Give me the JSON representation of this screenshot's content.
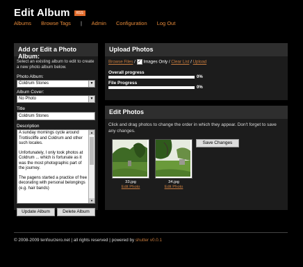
{
  "header": {
    "title": "Edit Album",
    "rss_badge": "RSS"
  },
  "nav": {
    "items": [
      "Albums",
      "Browse Tags",
      "Admin",
      "Configuration",
      "Log Out"
    ],
    "separator": "|"
  },
  "left_panel": {
    "title": "Add or Edit a Photo Album:",
    "help": "Select an existing album to edit to create a new photo album below.",
    "photo_album_label": "Photo Album:",
    "photo_album_value": "Coldrum Stones",
    "album_cover_label": "Album Cover:",
    "album_cover_value": "No Photo",
    "title_label": "Title",
    "title_value": "Coldrum Stones",
    "description_label": "Description",
    "description_p1": "A sunday mornings cycle around Trottiscliffe and Coldrum and other such locales.",
    "description_p2": "Unfortunately, I only took photos at Coldrum ... which is fortunate as it was the most photographic part of the journey.",
    "description_p3": "The pagens started a practice of free decorating with personal belongings (e.g. hair bands)",
    "update_button": "Update Album",
    "delete_button": "Delete Album"
  },
  "upload_panel": {
    "title": "Upload Photos",
    "browse_files": "Browse Files",
    "images_only": "Images Only",
    "clear_list": "Clear List",
    "upload": "Upload",
    "overall_label": "Overall progress",
    "overall_pct": "0%",
    "file_label": "File Progress",
    "file_pct": "0%",
    "overall_progress": 0,
    "file_progress": 0
  },
  "edit_panel": {
    "title": "Edit Photos",
    "help": "Click and drag photos to change the order in which they appear. Don't forget to save any changes.",
    "save_button": "Save Changes",
    "photos": [
      {
        "filename": "33.jpg",
        "edit_label": "Edit Photo"
      },
      {
        "filename": "34.jpg",
        "edit_label": "Edit Photo"
      }
    ]
  },
  "footer": {
    "text": "© 2008-2009 tenfourzero.net | all rights reserved | powered by",
    "link": "shutter v0.0.1"
  },
  "colors": {
    "accent": "#e88b3a",
    "link": "#c87c3e",
    "panel": "#1c1c1c",
    "panel_head": "#2e2e2e"
  }
}
